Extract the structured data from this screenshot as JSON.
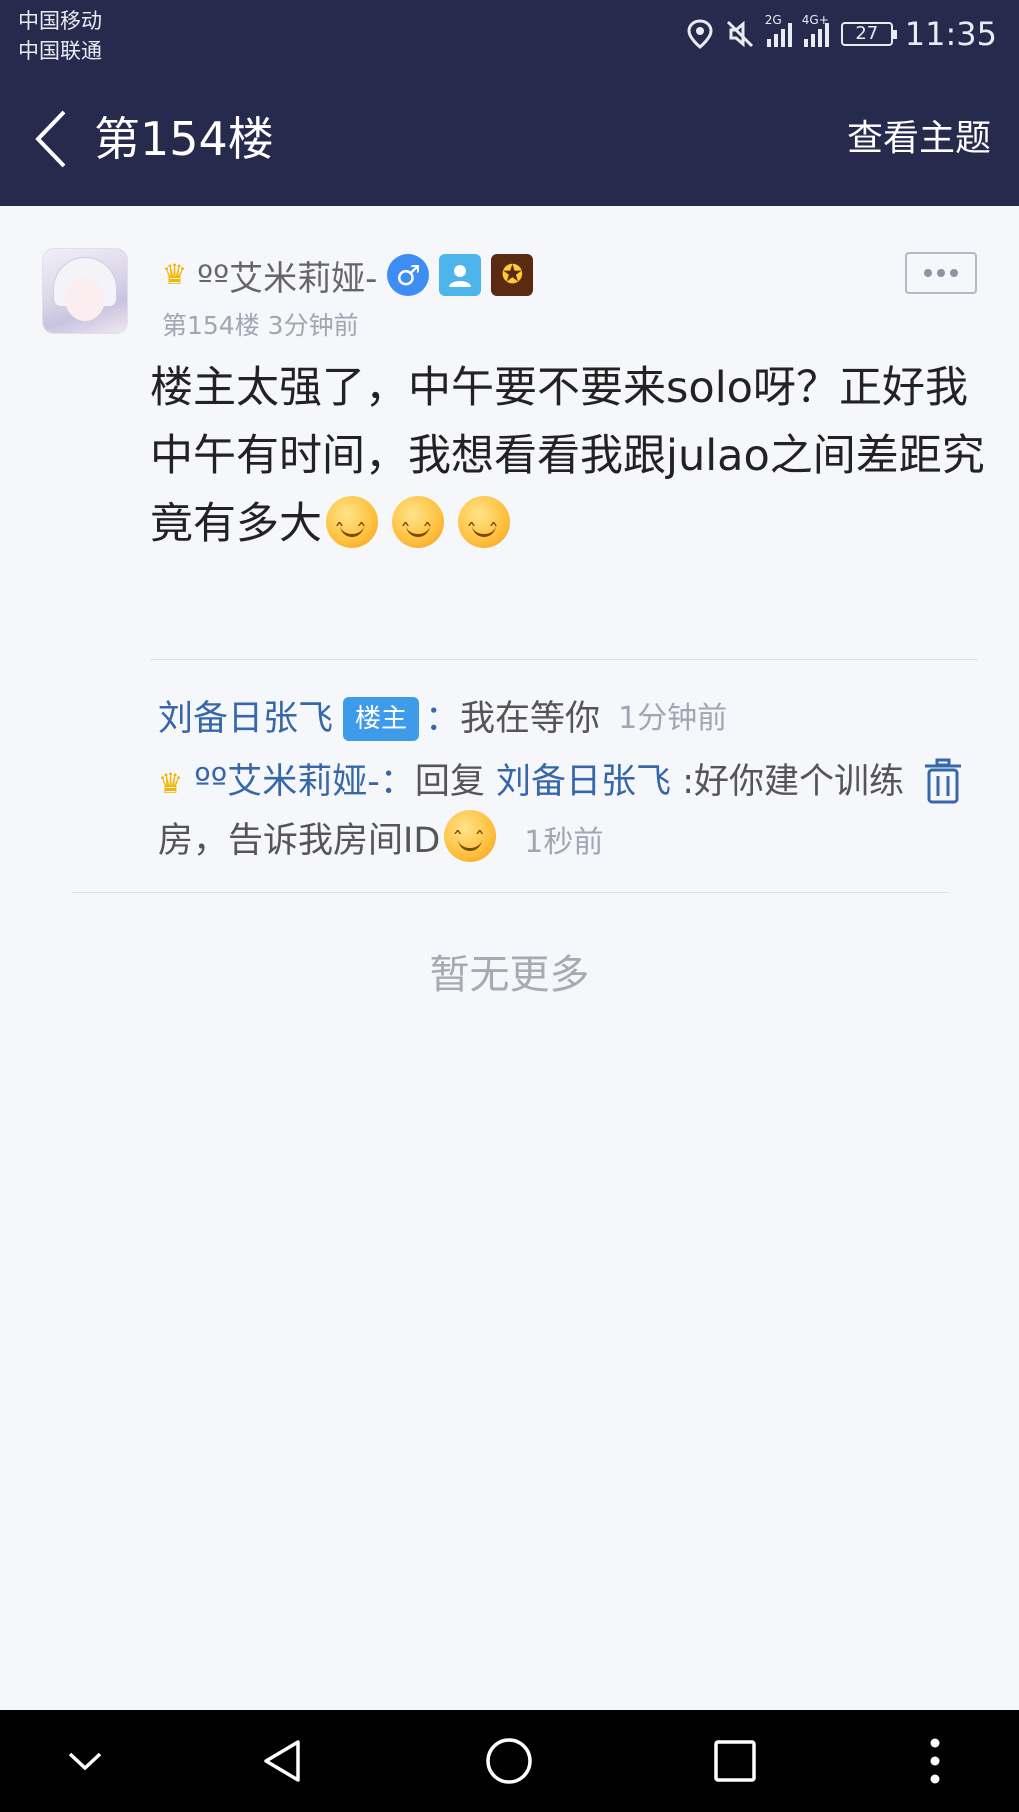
{
  "status_bar": {
    "carrier1": "中国移动",
    "carrier2": "中国联通",
    "net1": "2G",
    "net2": "4G+",
    "battery": "27",
    "time": "11:35"
  },
  "nav": {
    "title": "第154楼",
    "action": "查看主题"
  },
  "post": {
    "username": "ºº艾米莉娅-",
    "floor_info": "第154楼  3分钟前",
    "content": "楼主太强了，中午要不要来solo呀？正好我中午有时间，我想看看我跟julao之间差距究竟有多大"
  },
  "replies": [
    {
      "author": "刘备日张飞",
      "tag": "楼主",
      "sep": "：",
      "text": "我在等你",
      "time": "1分钟前"
    },
    {
      "author": "ºº艾米莉娅-",
      "sep": "：",
      "reply_word": "回复",
      "reply_to": "刘备日张飞",
      "text": " :好你建个训练房，告诉我房间ID",
      "time": "1秒前"
    }
  ],
  "footer_text": "暂无更多",
  "colors": {
    "header_bg": "#262b4d",
    "link_blue": "#3667a8",
    "tag_blue": "#3d9be9",
    "page_bg": "#f6f7fb"
  }
}
